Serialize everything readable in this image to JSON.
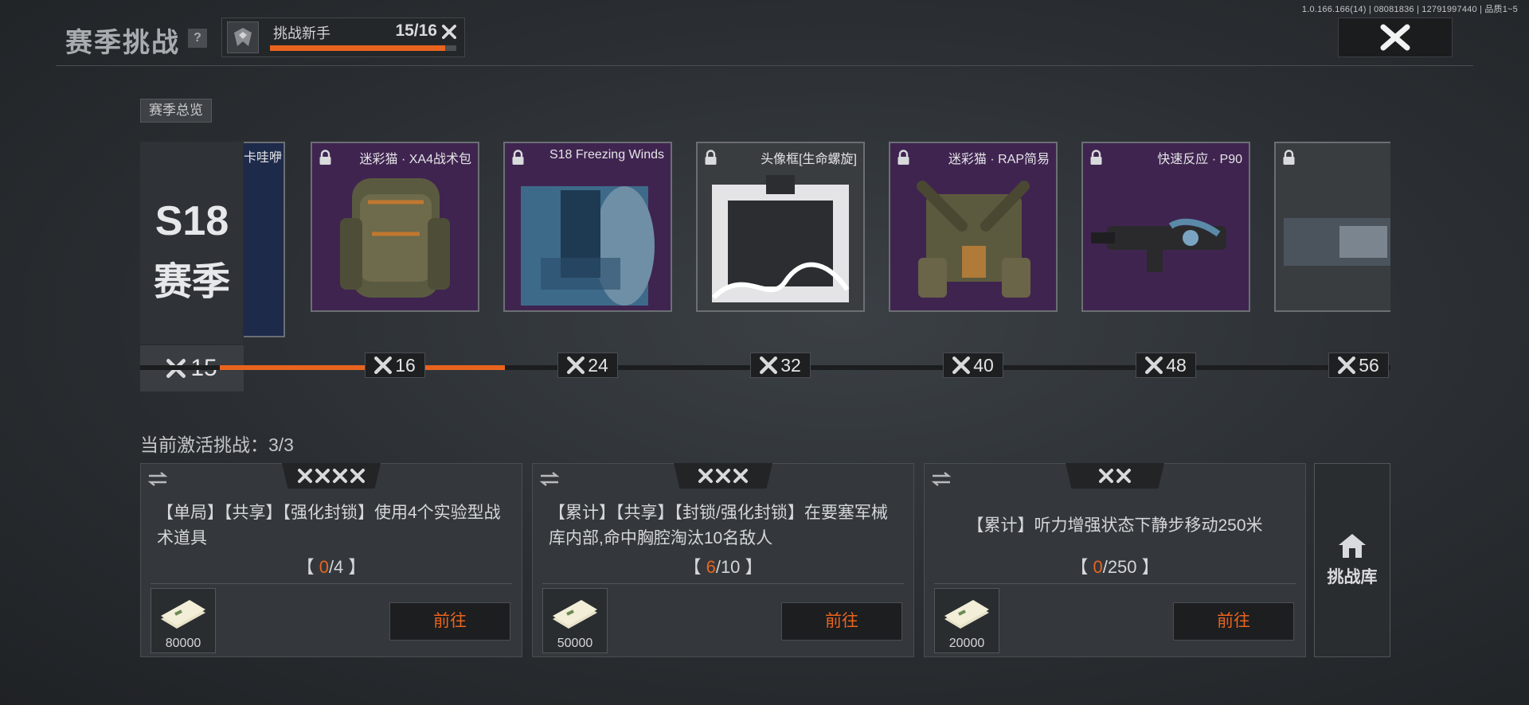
{
  "version": "1.0.166.166(14) | 08081836 | 12791997440 | 品质1~5",
  "header": {
    "title": "赛季挑战",
    "help_label": "?",
    "rank_name": "挑战新手",
    "rank_progress": "15/16",
    "rank_progress_fraction": 0.94
  },
  "overview_label": "赛季总览",
  "season": {
    "num": "S18",
    "label": "赛季",
    "level": "15",
    "prev_reward_name": "卡哇咿"
  },
  "track_progress_fraction": 0.25,
  "rewards": [
    {
      "name": "迷彩猫 · XA4战术包",
      "level": "16",
      "rarity": "purple",
      "locked": true
    },
    {
      "name": "S18 Freezing Winds",
      "level": "24",
      "rarity": "purple",
      "locked": true
    },
    {
      "name": "头像框[生命螺旋]",
      "level": "32",
      "rarity": "grey",
      "locked": true
    },
    {
      "name": "迷彩猫 · RAP简易",
      "level": "40",
      "rarity": "purple",
      "locked": true
    },
    {
      "name": "快速反应 · P90",
      "level": "48",
      "rarity": "purple",
      "locked": true
    },
    {
      "name": "",
      "level": "56",
      "rarity": "grey",
      "locked": true
    }
  ],
  "active": {
    "title": "当前激活挑战：3/3"
  },
  "challenges": [
    {
      "stars": 4,
      "desc": "【单局】【共享】【强化封锁】使用4个实验型战术道具",
      "progress_open": "【 ",
      "current": "0",
      "total": "/4",
      "progress_close": " 】",
      "reward": "80000",
      "go_label": "前往"
    },
    {
      "stars": 3,
      "desc": "【累计】【共享】【封锁/强化封锁】在要塞军械库内部,命中胸腔淘汰10名敌人",
      "progress_open": "【 ",
      "current": "6",
      "total": "/10",
      "progress_close": " 】",
      "reward": "50000",
      "go_label": "前往"
    },
    {
      "stars": 2,
      "desc": "【累计】听力增强状态下静步移动250米",
      "progress_open": "【 ",
      "current": "0",
      "total": "/250",
      "progress_close": " 】",
      "reward": "20000",
      "go_label": "前往"
    }
  ],
  "library_label": "挑战库",
  "colors": {
    "accent": "#e8641e",
    "purple_card": "#3f2450",
    "grey_card": "#3a3d40"
  },
  "icons": {
    "star": "star-icon",
    "lock": "lock-icon",
    "swap": "swap-icon",
    "close": "close-icon",
    "home": "library-icon",
    "money": "cash-bundle-icon"
  }
}
